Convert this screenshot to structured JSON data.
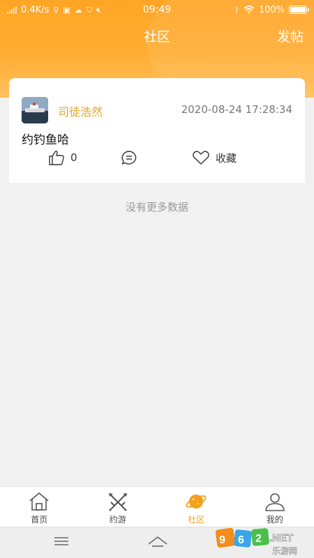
{
  "status_bar": {
    "speed": "0.4K/s",
    "time": "09:49",
    "battery": "100%"
  },
  "header": {
    "title": "社区",
    "post_label": "发帖"
  },
  "post": {
    "username": "司徒浩然",
    "timestamp": "2020-08-24 17:28:34",
    "content": "约钓鱼哈",
    "like_count": "0",
    "favorite_label": "收藏"
  },
  "feed": {
    "end_text": "没有更多数据"
  },
  "tabbar": {
    "tabs": [
      {
        "label": "首页",
        "icon": "home-icon"
      },
      {
        "label": "约游",
        "icon": "crossed-swords-icon"
      },
      {
        "label": "社区",
        "icon": "planet-icon",
        "active": true
      },
      {
        "label": "我的",
        "icon": "person-icon"
      }
    ]
  },
  "accent_color": "#ffa525",
  "active_tab_color": "#f3a01b",
  "username_color": "#e0a531",
  "watermark": {
    "brand_logo_text": "962.NET",
    "brand_caption": "乐游网"
  }
}
